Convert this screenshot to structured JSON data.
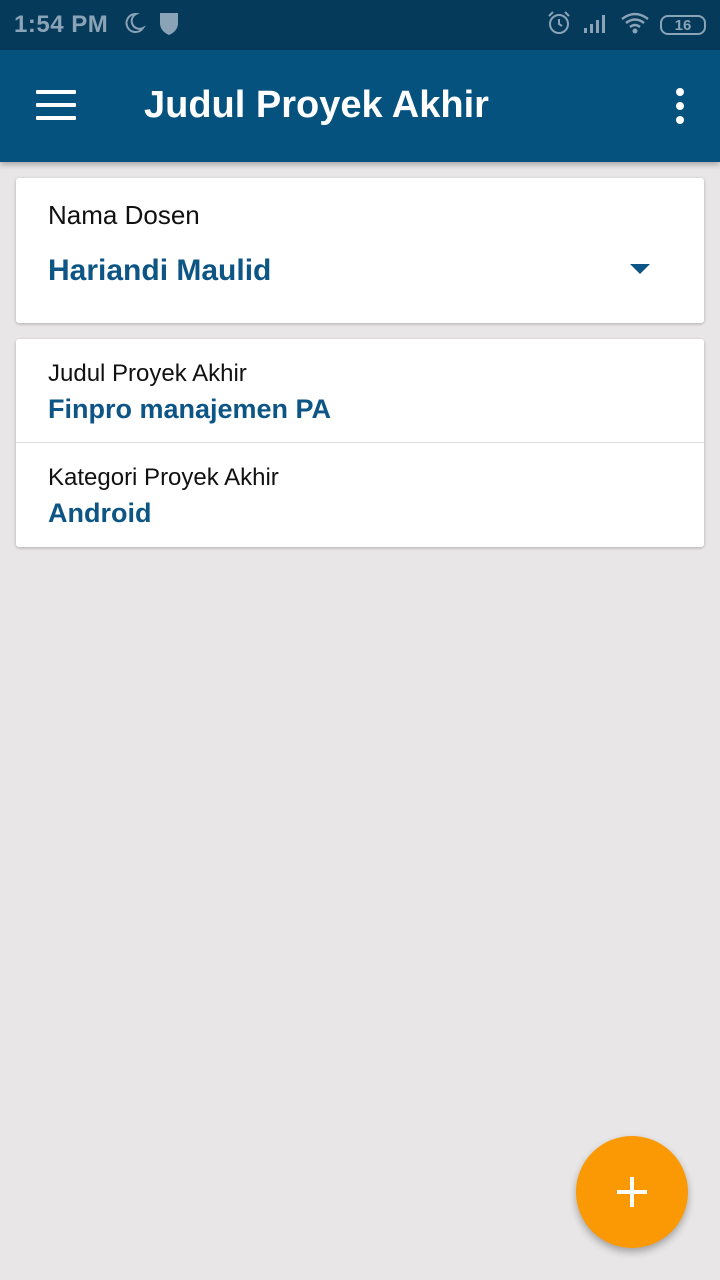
{
  "status_bar": {
    "time": "1:54 PM",
    "battery_level": "16",
    "icons": [
      "moon-icon",
      "shield-icon",
      "alarm-icon",
      "signal-icon",
      "wifi-icon",
      "battery-icon"
    ]
  },
  "app_bar": {
    "title": "Judul Proyek Akhir",
    "menu_icon": "hamburger-menu-icon",
    "overflow_icon": "more-vert-icon"
  },
  "dosen_card": {
    "label": "Nama Dosen",
    "selected_value": "Hariandi Maulid"
  },
  "info_card": {
    "rows": [
      {
        "label": "Judul Proyek Akhir",
        "value": "Finpro manajemen PA"
      },
      {
        "label": "Kategori Proyek Akhir",
        "value": "Android"
      }
    ]
  },
  "fab": {
    "icon": "plus-icon"
  },
  "colors": {
    "status_bar": "#053a5b",
    "app_bar": "#05527f",
    "accent_text": "#0d5585",
    "fab": "#fb9905",
    "background": "#e8e6e7"
  }
}
